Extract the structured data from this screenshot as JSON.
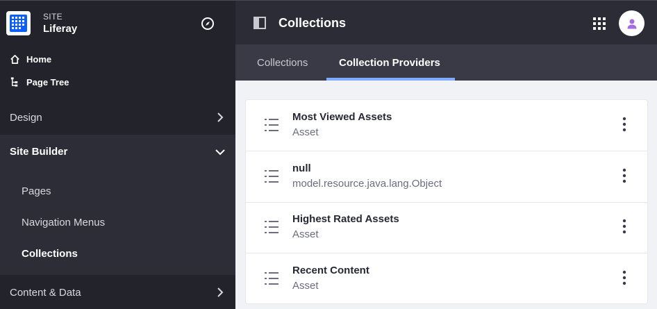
{
  "site": {
    "label": "SITE",
    "name": "Liferay"
  },
  "nav": {
    "home": "Home",
    "page_tree": "Page Tree",
    "design": "Design",
    "site_builder": "Site Builder",
    "sub_items": [
      "Pages",
      "Navigation Menus",
      "Collections"
    ],
    "content_data": "Content & Data"
  },
  "header": {
    "title": "Collections"
  },
  "tabs": [
    {
      "label": "Collections",
      "active": false
    },
    {
      "label": "Collection Providers",
      "active": true
    }
  ],
  "providers": [
    {
      "title": "Most Viewed Assets",
      "type": "Asset"
    },
    {
      "title": "null",
      "type": "model.resource.java.lang.Object"
    },
    {
      "title": "Highest Rated Assets",
      "type": "Asset"
    },
    {
      "title": "Recent Content",
      "type": "Asset"
    }
  ],
  "colors": {
    "accent": "#80acff",
    "brand": "#0b5fff",
    "sidebar": "#23232c",
    "avatar_icon": "#a76bdf"
  },
  "icons": {
    "compass": "compass-icon",
    "home": "home-icon",
    "page_tree": "page-tree-icon",
    "panel_toggle": "panel-toggle-icon",
    "apps": "apps-grid-icon",
    "user": "user-icon",
    "list": "list-icon",
    "kebab": "ellipsis-v-icon"
  }
}
